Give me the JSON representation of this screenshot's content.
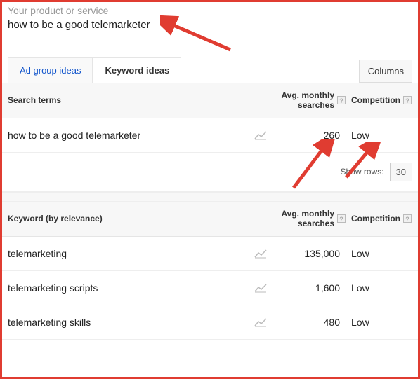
{
  "input": {
    "label": "Your product or service",
    "value": "how to be a good telemarketer"
  },
  "tabs": {
    "ad_group": "Ad group ideas",
    "keyword": "Keyword ideas",
    "columns": "Columns"
  },
  "table1": {
    "headers": {
      "term": "Search terms",
      "avg_line1": "Avg. monthly",
      "avg_line2": "searches",
      "comp": "Competition"
    },
    "rows": [
      {
        "term": "how to be a good telemarketer",
        "searches": "260",
        "competition": "Low"
      }
    ]
  },
  "footer": {
    "show_rows_label": "Show rows:",
    "show_rows_value": "30"
  },
  "table2": {
    "headers": {
      "term": "Keyword (by relevance)",
      "avg_line1": "Avg. monthly",
      "avg_line2": "searches",
      "comp": "Competition"
    },
    "rows": [
      {
        "term": "telemarketing",
        "searches": "135,000",
        "competition": "Low"
      },
      {
        "term": "telemarketing scripts",
        "searches": "1,600",
        "competition": "Low"
      },
      {
        "term": "telemarketing skills",
        "searches": "480",
        "competition": "Low"
      }
    ]
  },
  "help_glyph": "?"
}
